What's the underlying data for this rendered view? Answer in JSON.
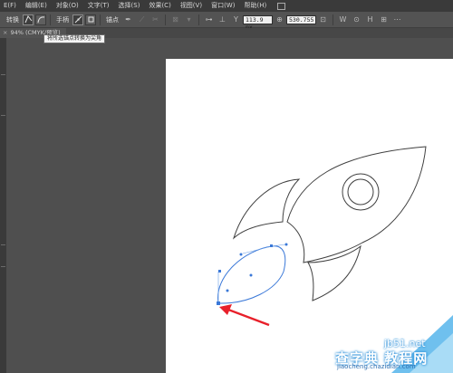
{
  "menubar": {
    "items": [
      "E(F)",
      "编辑(E)",
      "对象(O)",
      "文字(T)",
      "选择(S)",
      "效果(C)",
      "视图(V)",
      "窗口(W)",
      "帮助(H)"
    ]
  },
  "controlbar": {
    "convert_label": "转换",
    "handle_label": "手柄",
    "anchor_label": "锚点",
    "y_value": "113.9 px",
    "x_value": "530.755"
  },
  "tab": {
    "title": "94% (CMYK/预览)"
  },
  "tooltip": {
    "text": "将所选锚点转换为尖角"
  },
  "watermark": {
    "site": "jb51.net",
    "cn": "查字典 教程网",
    "url": "jiaocheng.chazidian.com"
  },
  "colors": {
    "accent_red": "#e8202a",
    "path_blue": "#3a78d8",
    "canvas": "#4f4f4f",
    "artboard": "#ffffff"
  }
}
